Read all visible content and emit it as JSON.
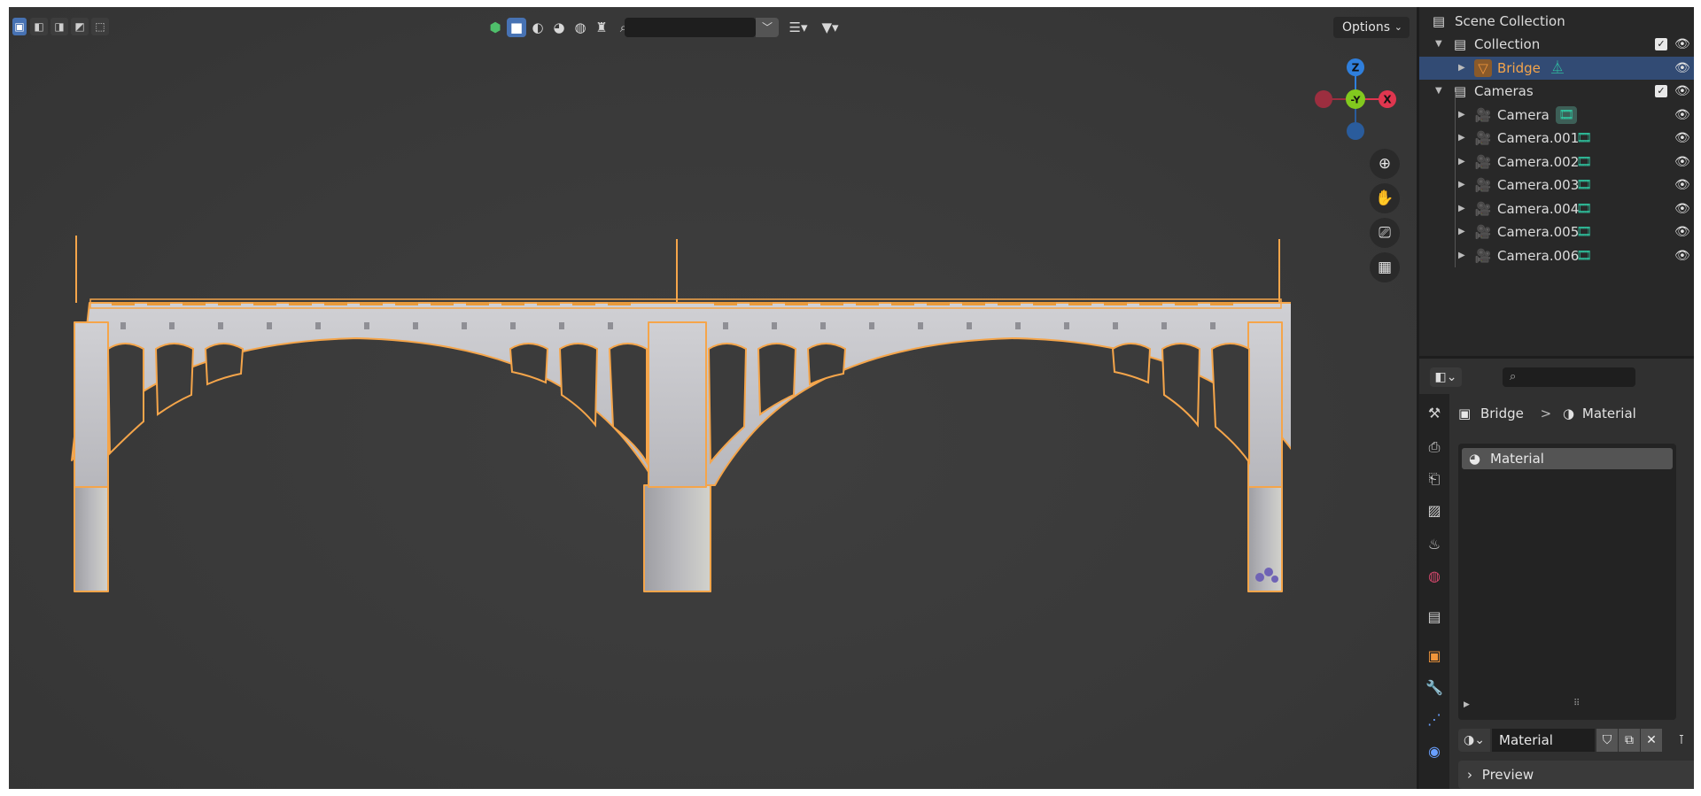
{
  "viewport": {
    "options_label": "Options",
    "search_placeholder": "",
    "gizmo": {
      "z_label": "Z",
      "y_label": "-Y",
      "x_label": "X"
    },
    "nav_tools": [
      "zoom-in-icon",
      "hand-pan-icon",
      "camera-view-icon",
      "grid-ortho-icon"
    ]
  },
  "outliner": {
    "root_label": "Scene Collection",
    "rows": [
      {
        "label": "Collection",
        "type": "collection",
        "indent": 1,
        "expanded": true,
        "checked": true
      },
      {
        "label": "Bridge",
        "type": "mesh",
        "indent": 2,
        "selected": true,
        "data_icon": "mesh-data-icon"
      },
      {
        "label": "Cameras",
        "type": "collection",
        "indent": 1,
        "expanded": true,
        "checked": true
      },
      {
        "label": "Camera",
        "type": "camera",
        "indent": 2,
        "data_icon": "camera-data-icon"
      },
      {
        "label": "Camera.001",
        "type": "camera",
        "indent": 2,
        "data_icon": "camera-data-icon"
      },
      {
        "label": "Camera.002",
        "type": "camera",
        "indent": 2,
        "data_icon": "camera-data-icon"
      },
      {
        "label": "Camera.003",
        "type": "camera",
        "indent": 2,
        "data_icon": "camera-data-icon"
      },
      {
        "label": "Camera.004",
        "type": "camera",
        "indent": 2,
        "data_icon": "camera-data-icon"
      },
      {
        "label": "Camera.005",
        "type": "camera",
        "indent": 2,
        "data_icon": "camera-data-icon"
      },
      {
        "label": "Camera.006",
        "type": "camera",
        "indent": 2,
        "data_icon": "camera-data-icon"
      }
    ]
  },
  "properties": {
    "breadcrumb": {
      "object": "Bridge",
      "separator": ">",
      "material": "Material"
    },
    "slot_label": "Material",
    "material_name": "Material",
    "preview_label": "Preview"
  },
  "colors": {
    "selection_orange": "#f5a54a",
    "selected_row": "#324b74",
    "accent_blue": "#4772b3",
    "axis_x": "#e0364f",
    "axis_y": "#82c91e",
    "axis_z": "#2f7fdc"
  }
}
